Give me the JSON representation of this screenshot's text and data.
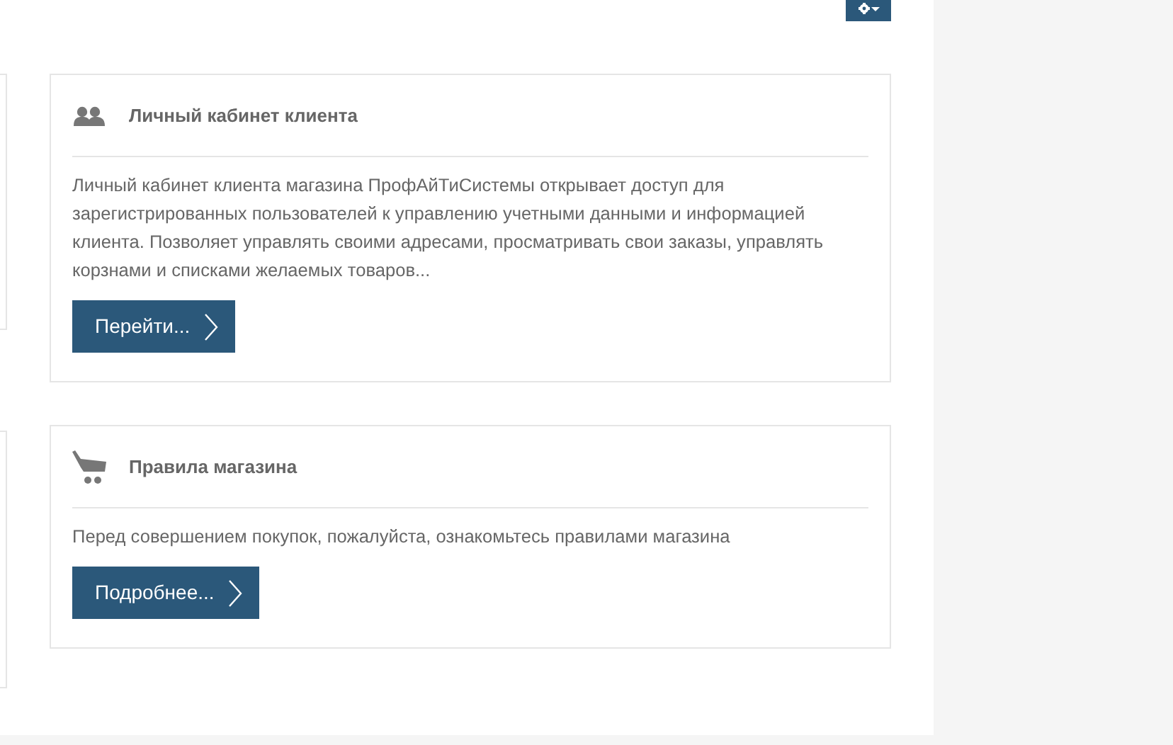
{
  "cards": [
    {
      "kind": "users",
      "title": "Личный кабинет клиента",
      "text": "Личный кабинет клиента магазина ПрофАйТиСистемы открывает доступ для зарегистрированных пользователей к управлению учетными данными и информацией клиента. Позволяет управлять своими адресами, просматривать свои заказы, управлять корзнами и списками желаемых товаров...",
      "button": "Перейти..."
    },
    {
      "kind": "cart",
      "title": "Правила магазина",
      "text": "Перед совершением покупок, пожалуйста, ознакомьтесь правилами магазина",
      "button": "Подробнее..."
    }
  ]
}
